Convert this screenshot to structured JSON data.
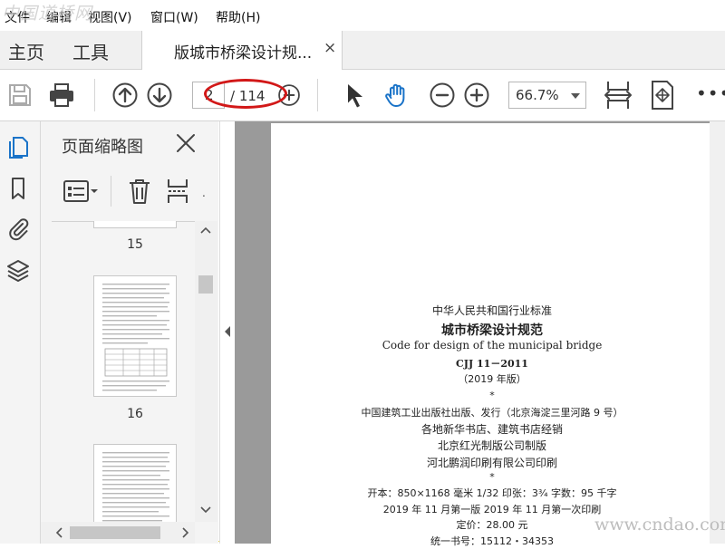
{
  "watermark_top": "中国道桥网",
  "watermark_bottom": "www.cndao.com",
  "menu": {
    "items": [
      {
        "label": "文件"
      },
      {
        "label": "编辑"
      },
      {
        "label": "视图(V)"
      },
      {
        "label": "窗口(W)"
      },
      {
        "label": "帮助(H)"
      }
    ]
  },
  "tabs": {
    "home": "主页",
    "tools": "工具",
    "document": "版城市桥梁设计规...",
    "close": "×"
  },
  "toolbar": {
    "page_current": "2",
    "page_total": "/ 114",
    "zoom": "66.7%",
    "more": "•••"
  },
  "colors": {
    "accent_blue": "#1a73c8",
    "annotation_red": "#d21818",
    "doc_background": "#9a9a9a",
    "frame_yellow": "#e8d24a"
  },
  "sidebar": {
    "title": "页面缩略图",
    "thumbnails": [
      {
        "label": "15"
      },
      {
        "label": "16"
      }
    ]
  },
  "document": {
    "lines": [
      "中华人民共和国行业标准",
      "城市桥梁设计规范",
      "Code for design of the municipal bridge",
      "CJJ 11－2011",
      "（2019 年版）",
      "*",
      "中国建筑工业出版社出版、发行（北京海淀三里河路 9 号）",
      "各地新华书店、建筑书店经销",
      "北京红光制版公司制版",
      "河北鹏润印刷有限公司印刷",
      "*",
      "开本：850×1168 毫米   1/32   印张：3¾   字数：95 千字",
      "2019 年 11 月第一版      2019 年 11 月第一次印刷",
      "定价：28.00 元",
      "统一书号：15112・34353"
    ]
  }
}
